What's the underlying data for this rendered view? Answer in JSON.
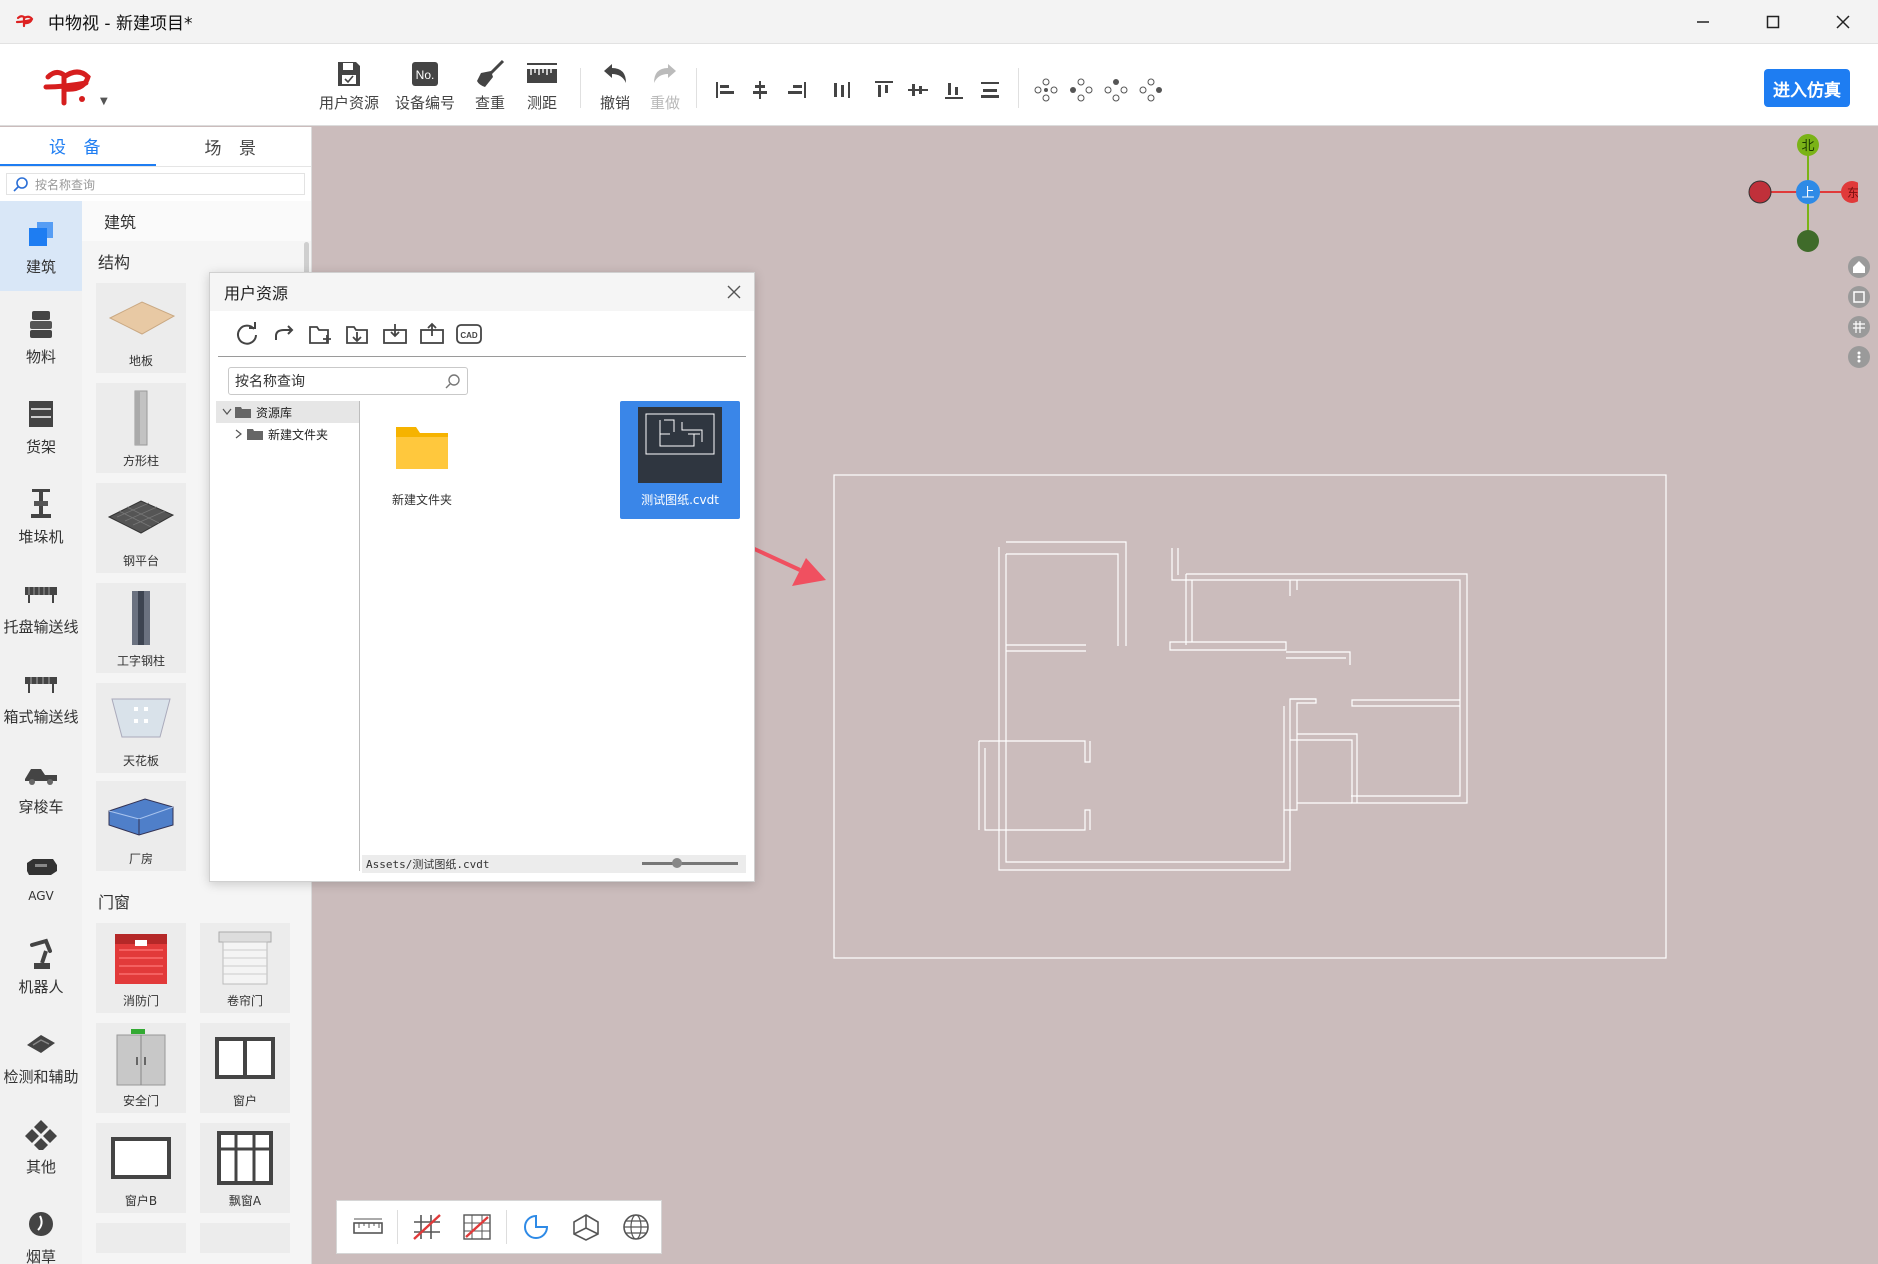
{
  "window": {
    "title": "中物视 - 新建项目*",
    "controls": [
      "minimize-icon",
      "maximize-icon",
      "close-icon"
    ]
  },
  "toolbar": {
    "tools": [
      {
        "name": "user-resources",
        "label": "用户资源",
        "icon": "floppy-icon"
      },
      {
        "name": "device-number",
        "label": "设备编号",
        "icon": "no-badge-icon"
      },
      {
        "name": "check-overlap",
        "label": "查重",
        "icon": "broom-icon"
      },
      {
        "name": "measure",
        "label": "测距",
        "icon": "ruler-icon"
      },
      {
        "name": "undo",
        "label": "撤销",
        "icon": "undo-icon"
      },
      {
        "name": "redo",
        "label": "重做",
        "icon": "redo-icon"
      }
    ],
    "no_badge_text": "No.",
    "primary_button": "进入仿真",
    "accent_color": "#1e7df2"
  },
  "leftpanel": {
    "tabs": [
      "设 备",
      "场 景"
    ],
    "active_tab": 0,
    "search_placeholder": "按名称查询",
    "categories": [
      "建筑",
      "物料",
      "货架",
      "堆垛机",
      "托盘输送线",
      "箱式输送线",
      "穿梭车",
      "AGV",
      "机器人",
      "检测和辅助",
      "其他",
      "烟草"
    ],
    "active_category": 0,
    "top_heading": "建筑",
    "sections": [
      {
        "title": "结构",
        "items": [
          "地板",
          "方形柱",
          "钢平台",
          "工字钢柱",
          "天花板",
          "厂房"
        ]
      },
      {
        "title": "门窗",
        "items": [
          "消防门",
          "卷帘门",
          "安全门",
          "窗户",
          "窗户B",
          "飘窗A"
        ]
      }
    ]
  },
  "dialog": {
    "title": "用户资源",
    "search_placeholder": "按名称查询",
    "tree": [
      {
        "label": "资源库",
        "expanded": true
      },
      {
        "label": "新建文件夹",
        "expanded": false
      }
    ],
    "files": [
      {
        "name": "新建文件夹",
        "type": "folder",
        "selected": false
      },
      {
        "name": "测试图纸.cvdt",
        "type": "drawing",
        "selected": true
      }
    ],
    "status_path": "Assets/测试图纸.cvdt",
    "cad_label": "CAD"
  },
  "compass": {
    "north": "北",
    "up": "上",
    "east": "东",
    "north_color": "#7ab317",
    "up_color": "#2e8ae6",
    "east_color": "#e03a3a",
    "west_color": "#c0303a",
    "south_color": "#3f6b2a"
  },
  "canvas": {
    "background": "#cbbcbc",
    "annotation_color": "#f05060"
  }
}
